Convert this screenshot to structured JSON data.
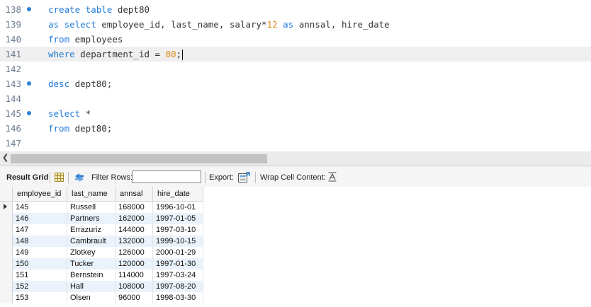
{
  "editor": {
    "lines": [
      {
        "n": "138",
        "marker": true,
        "tokens": [
          {
            "t": "create table",
            "c": "kw"
          },
          {
            "t": " dept80"
          }
        ]
      },
      {
        "n": "139",
        "marker": false,
        "tokens": [
          {
            "t": "as select",
            "c": "kw"
          },
          {
            "t": " employee_id, last_name, salary*"
          },
          {
            "t": "12",
            "c": "num"
          },
          {
            "t": " "
          },
          {
            "t": "as",
            "c": "kw"
          },
          {
            "t": " annsal, hire_date"
          }
        ]
      },
      {
        "n": "140",
        "marker": false,
        "tokens": [
          {
            "t": "from",
            "c": "kw"
          },
          {
            "t": " employees"
          }
        ]
      },
      {
        "n": "141",
        "marker": false,
        "current": true,
        "tokens": [
          {
            "t": "where",
            "c": "kw"
          },
          {
            "t": " department_id = "
          },
          {
            "t": "80",
            "c": "num"
          },
          {
            "t": ";"
          }
        ]
      },
      {
        "n": "142",
        "marker": false,
        "tokens": []
      },
      {
        "n": "143",
        "marker": true,
        "tokens": [
          {
            "t": "desc",
            "c": "kw"
          },
          {
            "t": " dept80;"
          }
        ]
      },
      {
        "n": "144",
        "marker": false,
        "tokens": []
      },
      {
        "n": "145",
        "marker": true,
        "tokens": [
          {
            "t": "select",
            "c": "kw"
          },
          {
            "t": " *"
          }
        ]
      },
      {
        "n": "146",
        "marker": false,
        "tokens": [
          {
            "t": "from",
            "c": "kw"
          },
          {
            "t": " dept80;"
          }
        ]
      },
      {
        "n": "147",
        "marker": false,
        "tokens": []
      }
    ]
  },
  "toolbar": {
    "result_grid_label": "Result Grid",
    "filter_label": "Filter Rows:",
    "filter_value": "",
    "export_label": "Export:",
    "wrap_label": "Wrap Cell Content:"
  },
  "grid": {
    "columns": [
      "employee_id",
      "last_name",
      "annsal",
      "hire_date"
    ],
    "rows": [
      [
        "145",
        "Russell",
        "168000",
        "1996-10-01"
      ],
      [
        "146",
        "Partners",
        "162000",
        "1997-01-05"
      ],
      [
        "147",
        "Errazuriz",
        "144000",
        "1997-03-10"
      ],
      [
        "148",
        "Cambrault",
        "132000",
        "1999-10-15"
      ],
      [
        "149",
        "Zlotkey",
        "126000",
        "2000-01-29"
      ],
      [
        "150",
        "Tucker",
        "120000",
        "1997-01-30"
      ],
      [
        "151",
        "Bernstein",
        "114000",
        "1997-03-24"
      ],
      [
        "152",
        "Hall",
        "108000",
        "1997-08-20"
      ],
      [
        "153",
        "Olsen",
        "96000",
        "1998-03-30"
      ]
    ]
  },
  "colors": {
    "keyword": "#1f7ad8",
    "number": "#e08a1e",
    "row_alt": "#eaf2fb"
  }
}
